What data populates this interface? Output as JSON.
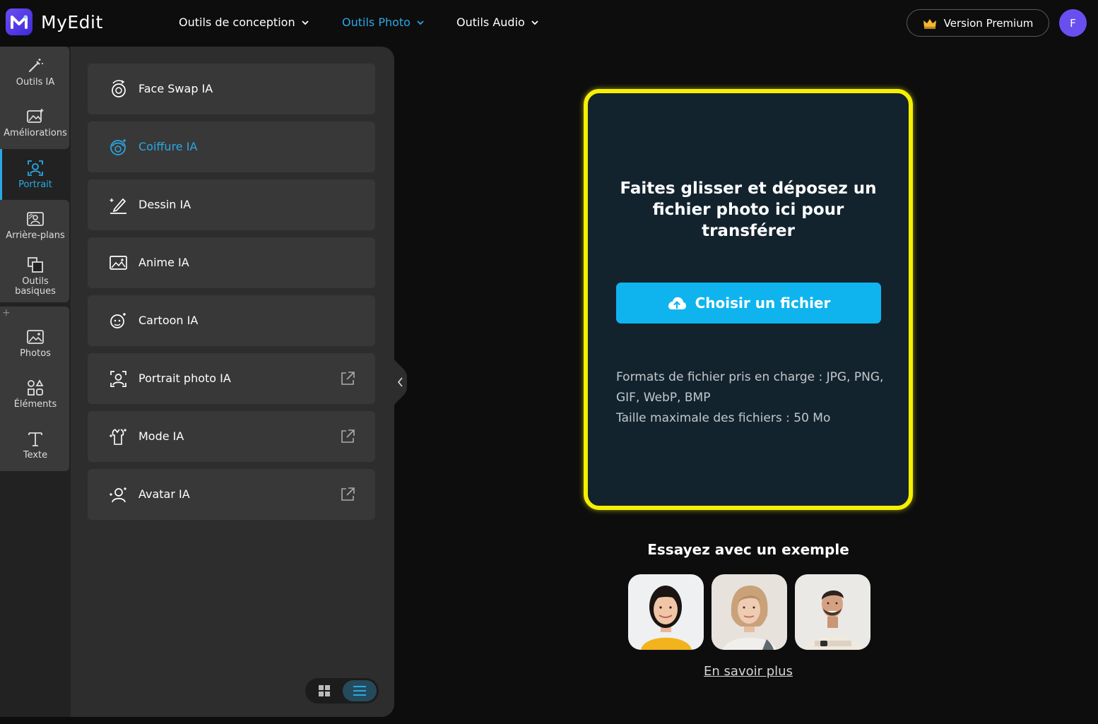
{
  "header": {
    "logo_text": "MyEdit",
    "nav": [
      {
        "label": "Outils de conception",
        "active": false
      },
      {
        "label": "Outils Photo",
        "active": true
      },
      {
        "label": "Outils Audio",
        "active": false
      }
    ],
    "premium_label": "Version Premium",
    "avatar_initial": "F"
  },
  "rail": {
    "items": [
      {
        "label": "Outils IA",
        "icon": "magic-wand-icon"
      },
      {
        "label": "Améliorations",
        "icon": "image-sparkle-icon"
      },
      {
        "label": "Portrait",
        "icon": "portrait-icon",
        "active": true
      },
      {
        "label": "Arrière-plans",
        "icon": "background-icon"
      },
      {
        "label": "Outils basiques",
        "icon": "crop-icon"
      },
      {
        "label": "Photos",
        "icon": "photo-icon"
      },
      {
        "label": "Éléments",
        "icon": "shapes-icon"
      },
      {
        "label": "Texte",
        "icon": "text-icon"
      }
    ],
    "plus": "+"
  },
  "tools": [
    {
      "label": "Face Swap IA",
      "icon": "face-swap-icon",
      "external": false
    },
    {
      "label": "Coiffure IA",
      "icon": "hairstyle-icon",
      "external": false,
      "active": true
    },
    {
      "label": "Dessin IA",
      "icon": "drawing-icon",
      "external": false
    },
    {
      "label": "Anime IA",
      "icon": "anime-icon",
      "external": false
    },
    {
      "label": "Cartoon IA",
      "icon": "cartoon-icon",
      "external": false
    },
    {
      "label": "Portrait photo IA",
      "icon": "portrait-photo-icon",
      "external": true
    },
    {
      "label": "Mode IA",
      "icon": "fashion-icon",
      "external": true
    },
    {
      "label": "Avatar IA",
      "icon": "avatar-icon",
      "external": true
    }
  ],
  "upload": {
    "title": "Faites glisser et déposez un fichier photo ici pour transférer",
    "button_label": "Choisir un fichier",
    "formats_line1": "Formats de fichier pris en charge : JPG, PNG, GIF, WebP, BMP",
    "formats_line2": "Taille maximale des fichiers : 50 Mo"
  },
  "examples": {
    "title": "Essayez avec un exemple",
    "learn_more": "En savoir plus"
  },
  "colors": {
    "accent": "#2aa8e6",
    "highlight": "#f5f002",
    "button": "#0fb4ee",
    "premium_crown": "#f5b82e",
    "avatar_bg": "#6a4ff0"
  }
}
